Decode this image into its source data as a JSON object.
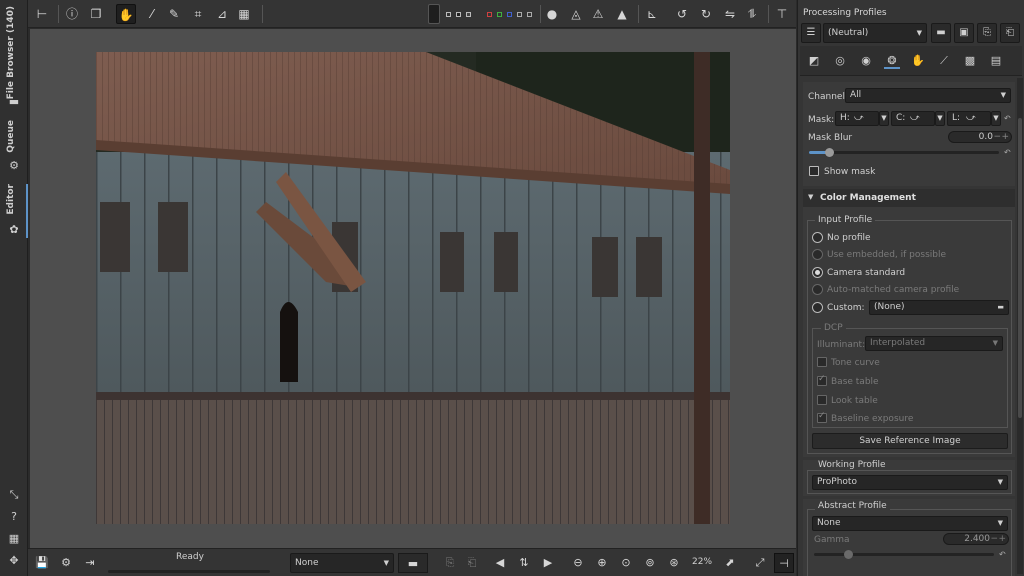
{
  "left_tabs": {
    "file_browser": "File Browser (140)",
    "queue": "Queue",
    "editor": "Editor"
  },
  "bottom_bar": {
    "status": "Ready",
    "profile_select": "None",
    "zoom": "22%"
  },
  "right_panel": {
    "title": "Processing Profiles",
    "profile_select": "(Neutral)",
    "channel_label": "Channel:",
    "channel_value": "All",
    "mask_label": "Mask:",
    "mask_h": "H:",
    "mask_c": "C:",
    "mask_l": "L:",
    "mask_blur_label": "Mask Blur",
    "mask_blur_value": "0.0",
    "show_mask": "Show mask",
    "color_management": "Color Management",
    "input_profile": {
      "title": "Input Profile",
      "no_profile": "No profile",
      "use_embedded": "Use embedded, if possible",
      "camera_standard": "Camera standard",
      "auto_matched": "Auto-matched camera profile",
      "custom": "Custom:",
      "custom_value": "(None)"
    },
    "dcp": {
      "title": "DCP",
      "illuminant_label": "Illuminant:",
      "illuminant_value": "Interpolated",
      "tone_curve": "Tone curve",
      "base_table": "Base table",
      "look_table": "Look table",
      "baseline_exposure": "Baseline exposure"
    },
    "save_reference": "Save Reference Image",
    "working_profile": {
      "title": "Working Profile",
      "value": "ProPhoto"
    },
    "abstract_profile": {
      "title": "Abstract Profile",
      "value": "None",
      "gamma_label": "Gamma",
      "gamma_value": "2.400"
    }
  }
}
